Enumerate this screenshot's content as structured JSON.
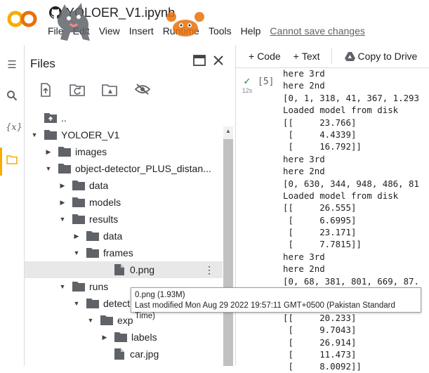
{
  "app": {
    "logo_text": "CO",
    "notebook_title": "YOLOER_V1.ipynb",
    "menu": [
      "File",
      "Edit",
      "View",
      "Insert",
      "Runtime",
      "Tools",
      "Help"
    ],
    "save_warning": "Cannot save changes",
    "colors": {
      "logo_orange": "#f9ab00",
      "check_green": "#188038",
      "active_bar": "#f9ab00"
    }
  },
  "files_panel": {
    "title": "Files",
    "tree": [
      {
        "label": "..",
        "icon": "folder-up-icon",
        "arrow": "",
        "depth": 0
      },
      {
        "label": "YOLOER_V1",
        "icon": "folder-icon",
        "arrow": "down",
        "depth": 0
      },
      {
        "label": "images",
        "icon": "folder-icon",
        "arrow": "right",
        "depth": 1
      },
      {
        "label": "object-detector_PLUS_distan...",
        "icon": "folder-icon",
        "arrow": "down",
        "depth": 1
      },
      {
        "label": "data",
        "icon": "folder-icon",
        "arrow": "right",
        "depth": 2
      },
      {
        "label": "models",
        "icon": "folder-icon",
        "arrow": "right",
        "depth": 2
      },
      {
        "label": "results",
        "icon": "folder-icon",
        "arrow": "down",
        "depth": 2
      },
      {
        "label": "data",
        "icon": "folder-icon",
        "arrow": "right",
        "depth": 3
      },
      {
        "label": "frames",
        "icon": "folder-icon",
        "arrow": "down",
        "depth": 3
      },
      {
        "label": "0.png",
        "icon": "file-icon",
        "arrow": "",
        "depth": 5,
        "selected": true
      },
      {
        "label": "runs",
        "icon": "folder-icon",
        "arrow": "down",
        "depth": 2
      },
      {
        "label": "detect",
        "icon": "folder-icon",
        "arrow": "down",
        "depth": 3
      },
      {
        "label": "exp",
        "icon": "folder-icon",
        "arrow": "down",
        "depth": 4
      },
      {
        "label": "labels",
        "icon": "folder-icon",
        "arrow": "right",
        "depth": 5
      },
      {
        "label": "car.jpg",
        "icon": "file-icon",
        "arrow": "",
        "depth": 5
      }
    ]
  },
  "toolbar": {
    "code_label": "Code",
    "text_label": "Text",
    "copy_label": "Copy to Drive"
  },
  "cell": {
    "exec_time": "12s",
    "number": "[5]",
    "output_lines": [
      "here 3rd",
      "here 2nd",
      "[0, 1, 318, 41, 367, 1.293",
      "Loaded model from disk",
      "[[     23.766]",
      " [     4.4339]",
      " [     16.792]]",
      "here 3rd",
      "here 2nd",
      "[0, 630, 344, 948, 486, 81",
      "Loaded model from disk",
      "[[     26.555]",
      " [     6.6995]",
      " [     23.171]",
      " [     7.7815]]",
      "here 3rd",
      "here 2nd",
      "[0, 68, 381, 801, 669, 87.",
      "",
      "",
      "[[     20.233]",
      " [     9.7043]",
      " [     26.914]",
      " [     11.473]",
      " [     8.0092]]"
    ]
  },
  "tooltip": {
    "line1": "0.png (1.93M)",
    "line2": "Last modified Mon Aug 29 2022 19:57:11 GMT+0500 (Pakistan Standard Time)"
  }
}
